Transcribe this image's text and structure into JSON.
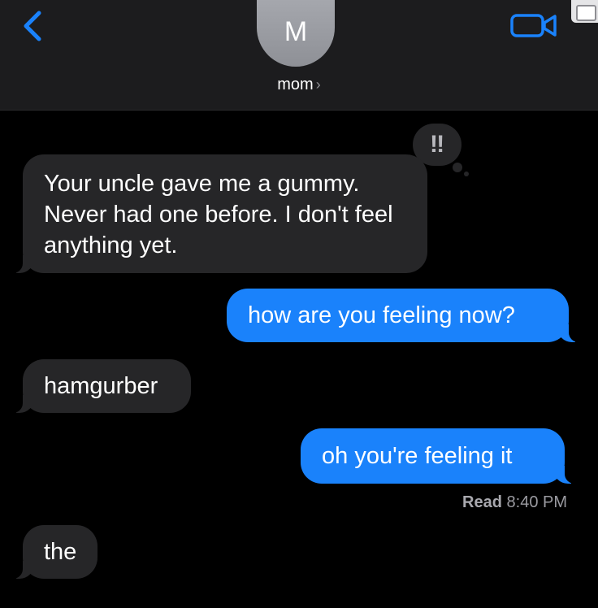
{
  "header": {
    "avatar_initial": "M",
    "contact_name": "mom",
    "chevron": "›",
    "back_icon": "chevron-left-icon",
    "video_icon": "video-camera-icon",
    "accent_color": "#1a82fb"
  },
  "messages": [
    {
      "direction": "incoming",
      "text": "Your uncle gave me a gummy. Never had one before. I don't feel anything yet."
    },
    {
      "direction": "outgoing",
      "text": "how are you feeling now?"
    },
    {
      "direction": "incoming",
      "text": "hamgurber"
    },
    {
      "direction": "outgoing",
      "text": "oh you're feeling it"
    },
    {
      "direction": "incoming",
      "text": "the"
    }
  ],
  "tapback": {
    "symbol": "‼",
    "icon": "exclamation-tapback-icon"
  },
  "read_receipt": {
    "label": "Read",
    "time": "8:40 PM"
  },
  "colors": {
    "incoming_bubble": "#262628",
    "outgoing_bubble": "#1a82fb",
    "background": "#000000",
    "header_bg": "#1c1c1e"
  }
}
